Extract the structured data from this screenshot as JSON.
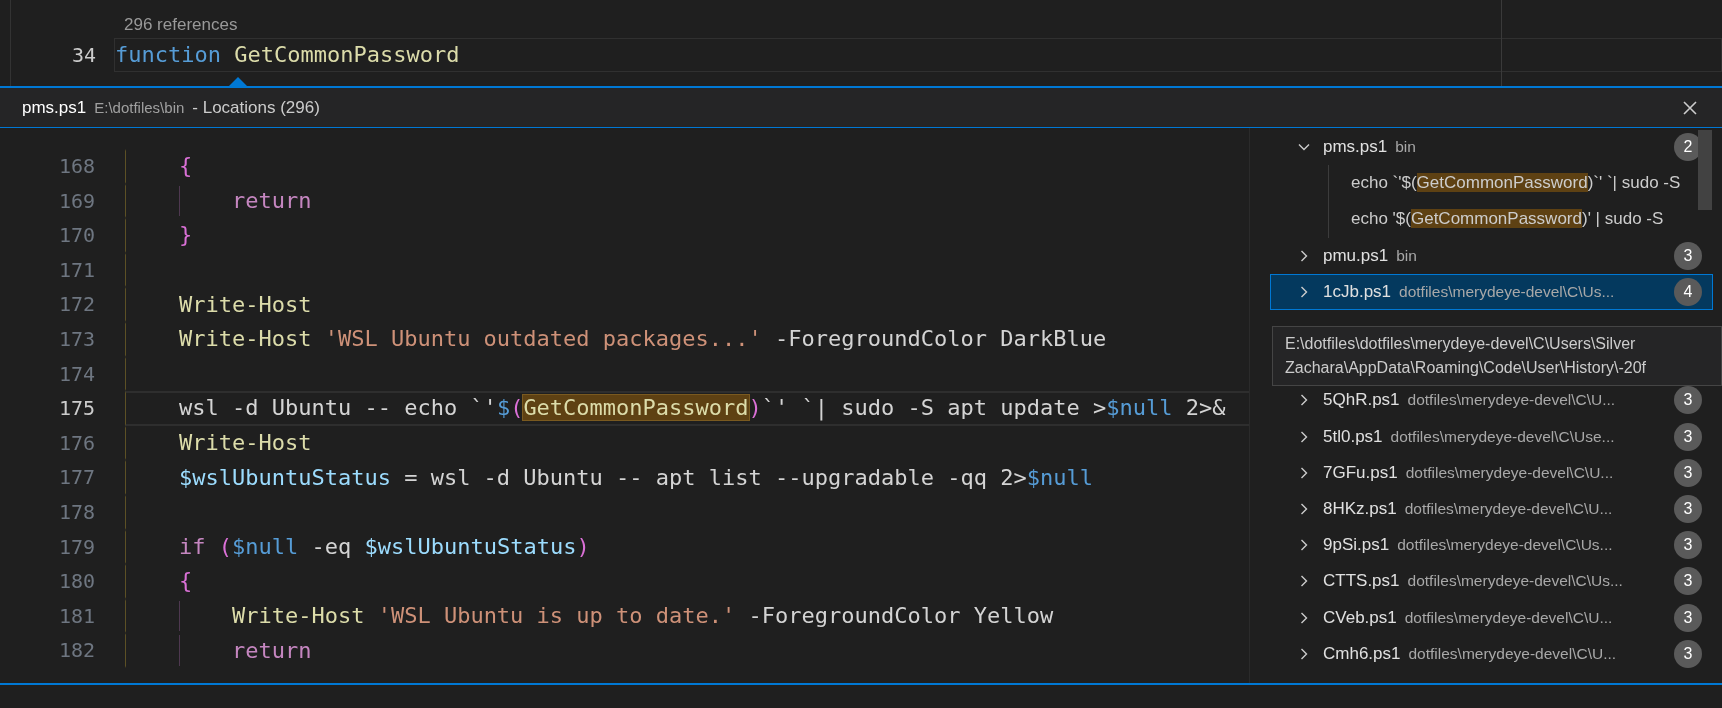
{
  "editor": {
    "codelens": "296 references",
    "line": {
      "number": "34",
      "current": true,
      "tokens": [
        {
          "kind": "storage",
          "text": "function"
        },
        {
          "kind": "func",
          "text": " GetCommonPassword"
        }
      ]
    }
  },
  "peek": {
    "file_name": "pms.ps1",
    "file_path": "E:\\dotfiles\\bin",
    "title": "- Locations (296)",
    "lines": [
      {
        "number": "168",
        "current": false,
        "tokens": [
          {
            "kind": "bracket",
            "text": "    {"
          }
        ]
      },
      {
        "number": "169",
        "current": false,
        "tokens": [
          {
            "kind": "keyword",
            "text": "        return"
          }
        ]
      },
      {
        "number": "170",
        "current": false,
        "tokens": [
          {
            "kind": "bracket",
            "text": "    }"
          }
        ]
      },
      {
        "number": "171",
        "current": false
      },
      {
        "number": "172",
        "current": false,
        "tokens": [
          {
            "kind": "func",
            "text": "    Write-Host"
          }
        ]
      },
      {
        "number": "173",
        "current": false,
        "tokens": [
          {
            "kind": "func",
            "text": "    Write-Host"
          },
          {
            "kind": "string",
            "text": " 'WSL Ubuntu outdated packages...'"
          },
          {
            "kind": "plain",
            "text": " -ForegroundColor DarkBlue"
          }
        ]
      },
      {
        "number": "174",
        "current": false
      },
      {
        "number": "175",
        "current": true,
        "tokens": [
          {
            "kind": "plain",
            "text": "    wsl -d Ubuntu -- echo `'"
          },
          {
            "kind": "const",
            "text": "$"
          },
          {
            "kind": "bracket",
            "text": "("
          },
          {
            "kind": "match",
            "text": "GetCommonPassword"
          },
          {
            "kind": "bracket",
            "text": ")"
          },
          {
            "kind": "plain",
            "text": "`' `| sudo -S apt update >"
          },
          {
            "kind": "const",
            "text": "$null"
          },
          {
            "kind": "plain",
            "text": " 2>&"
          }
        ]
      },
      {
        "number": "176",
        "current": false,
        "tokens": [
          {
            "kind": "func",
            "text": "    Write-Host"
          }
        ]
      },
      {
        "number": "177",
        "current": false,
        "tokens": [
          {
            "kind": "var",
            "text": "    $wslUbuntuStatus"
          },
          {
            "kind": "plain",
            "text": " = wsl -d Ubuntu -- apt list --upgradable -qq 2>"
          },
          {
            "kind": "const",
            "text": "$null"
          }
        ]
      },
      {
        "number": "178",
        "current": false
      },
      {
        "number": "179",
        "current": false,
        "tokens": [
          {
            "kind": "keyword",
            "text": "    if"
          },
          {
            "kind": "bracket",
            "text": " ("
          },
          {
            "kind": "const",
            "text": "$null"
          },
          {
            "kind": "plain",
            "text": " -eq "
          },
          {
            "kind": "var",
            "text": "$wslUbuntuStatus"
          },
          {
            "kind": "bracket",
            "text": ")"
          }
        ]
      },
      {
        "number": "180",
        "current": false,
        "tokens": [
          {
            "kind": "bracket",
            "text": "    {"
          }
        ]
      },
      {
        "number": "181",
        "current": false,
        "tokens": [
          {
            "kind": "func",
            "text": "        Write-Host"
          },
          {
            "kind": "string",
            "text": " 'WSL Ubuntu is up to date.'"
          },
          {
            "kind": "plain",
            "text": " -ForegroundColor Yellow"
          }
        ]
      },
      {
        "number": "182",
        "current": false,
        "tokens": [
          {
            "kind": "keyword",
            "text": "        return"
          }
        ]
      }
    ],
    "results": [
      {
        "kind": "file",
        "name": "pms.ps1",
        "path": "bin",
        "count": "2",
        "expanded": true,
        "selected": false,
        "children": [
          {
            "kind": "match",
            "before": "echo `'$(",
            "match": "GetCommonPassword",
            "after": ")`' `| sudo -S"
          },
          {
            "kind": "match",
            "before": "echo '$(",
            "match": "GetCommonPassword",
            "after": ")' | sudo -S"
          }
        ]
      },
      {
        "kind": "file",
        "name": "pmu.ps1",
        "path": "bin",
        "count": "3",
        "expanded": false,
        "selected": false
      },
      {
        "kind": "file",
        "name": "1cJb.ps1",
        "path": "dotfiles\\merydeye-devel\\C\\Us...",
        "count": "4",
        "expanded": false,
        "selected": true
      },
      {
        "kind": "hidden"
      },
      {
        "kind": "hidden"
      },
      {
        "kind": "file",
        "name": "5QhR.ps1",
        "path": "dotfiles\\merydeye-devel\\C\\U...",
        "count": "3",
        "expanded": false,
        "selected": false
      },
      {
        "kind": "file",
        "name": "5tl0.ps1",
        "path": "dotfiles\\merydeye-devel\\C\\Use...",
        "count": "3",
        "expanded": false,
        "selected": false
      },
      {
        "kind": "file",
        "name": "7GFu.ps1",
        "path": "dotfiles\\merydeye-devel\\C\\U...",
        "count": "3",
        "expanded": false,
        "selected": false
      },
      {
        "kind": "file",
        "name": "8HKz.ps1",
        "path": "dotfiles\\merydeye-devel\\C\\U...",
        "count": "3",
        "expanded": false,
        "selected": false
      },
      {
        "kind": "file",
        "name": "9pSi.ps1",
        "path": "dotfiles\\merydeye-devel\\C\\Us...",
        "count": "3",
        "expanded": false,
        "selected": false
      },
      {
        "kind": "file",
        "name": "CTTS.ps1",
        "path": "dotfiles\\merydeye-devel\\C\\Us...",
        "count": "3",
        "expanded": false,
        "selected": false
      },
      {
        "kind": "file",
        "name": "CVeb.ps1",
        "path": "dotfiles\\merydeye-devel\\C\\U...",
        "count": "3",
        "expanded": false,
        "selected": false
      },
      {
        "kind": "file",
        "name": "Cmh6.ps1",
        "path": "dotfiles\\merydeye-devel\\C\\U...",
        "count": "3",
        "expanded": false,
        "selected": false
      }
    ],
    "tooltip": [
      "E:\\dotfiles\\dotfiles\\merydeye-devel\\C\\Users\\Silver",
      "Zachara\\AppData\\Roaming\\Code\\User\\History\\-20f"
    ]
  }
}
